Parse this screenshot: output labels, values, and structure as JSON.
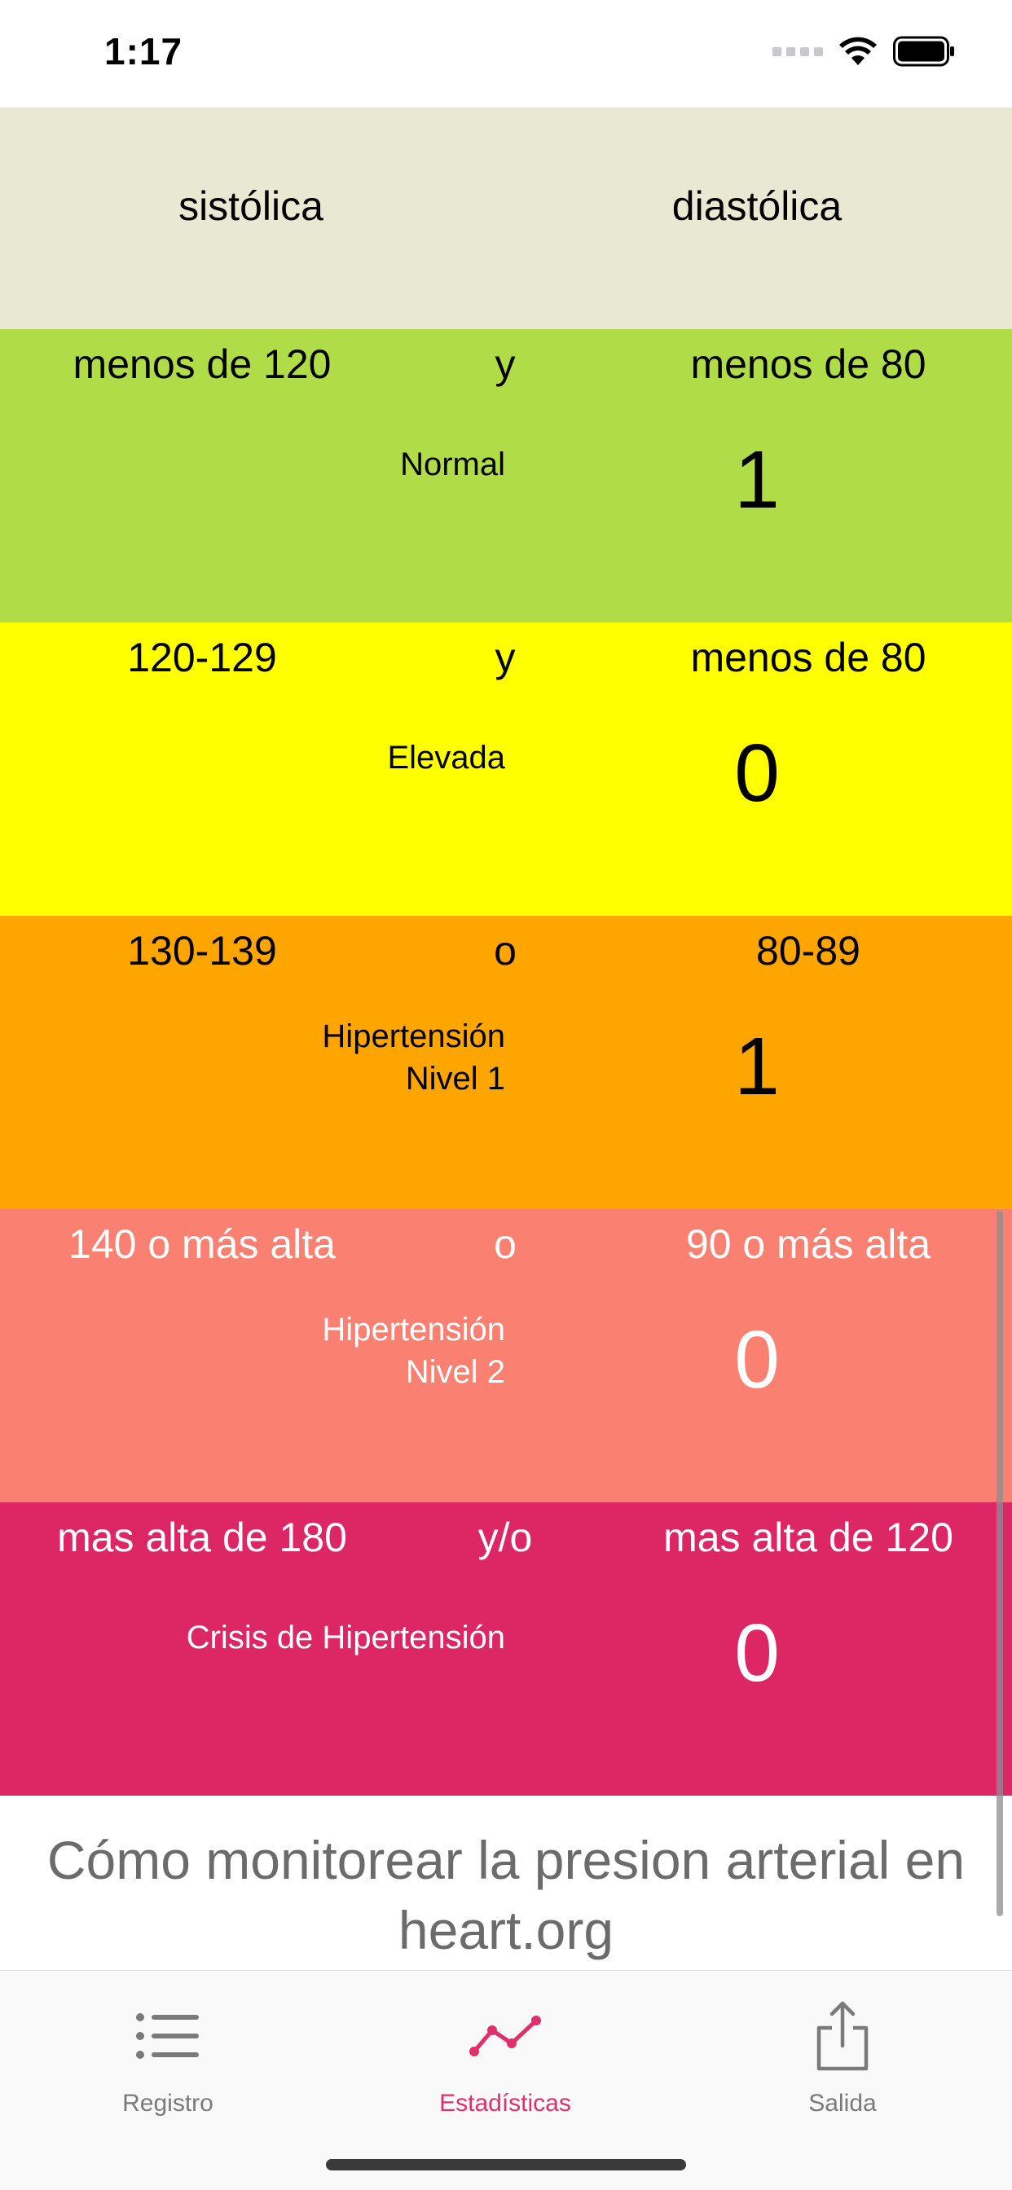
{
  "status_bar": {
    "time": "1:17"
  },
  "header": {
    "systolic": "sistólica",
    "diastolic": "diastólica"
  },
  "bands": [
    {
      "systolic": "menos de 120",
      "conj": "y",
      "diastolic": "menos de 80",
      "category": "Normal",
      "count": "1",
      "color": "#b0dd47",
      "text_color": "#000000"
    },
    {
      "systolic": "120-129",
      "conj": "y",
      "diastolic": "menos de 80",
      "category": "Elevada",
      "count": "0",
      "color": "#ffff00",
      "text_color": "#000000"
    },
    {
      "systolic": "130-139",
      "conj": "o",
      "diastolic": "80-89",
      "category": "Hipertensión\nNivel 1",
      "count": "1",
      "color": "#ffa500",
      "text_color": "#000000"
    },
    {
      "systolic": "140 o más alta",
      "conj": "o",
      "diastolic": "90 o más alta",
      "category": "Hipertensión\nNivel 2",
      "count": "0",
      "color": "#fa8072",
      "text_color": "#ffffff"
    },
    {
      "systolic": "mas alta de 180",
      "conj": "y/o",
      "diastolic": "mas alta de 120",
      "category": "Crisis de Hipertensión",
      "count": "0",
      "color": "#dd2764",
      "text_color": "#ffffff"
    }
  ],
  "link": {
    "text": "Cómo monitorear la presion arterial en heart.org"
  },
  "tabs": [
    {
      "label": "Registro",
      "icon": "list-icon",
      "active": false
    },
    {
      "label": "Estadísticas",
      "icon": "chart-line-icon",
      "active": true
    },
    {
      "label": "Salida",
      "icon": "share-icon",
      "active": false
    }
  ],
  "colors": {
    "accent": "#e0306a",
    "inactive_tab": "#7a7a7a",
    "header_bg": "#e9e8d3"
  }
}
